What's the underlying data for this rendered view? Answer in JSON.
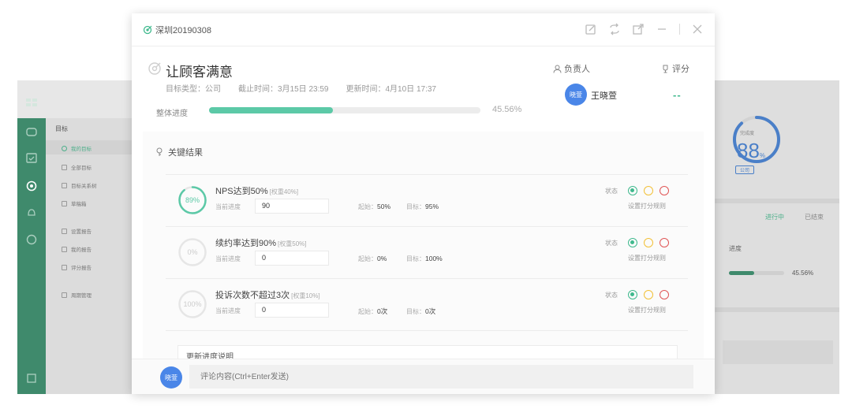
{
  "background": {
    "sidebar": {
      "title": "目标",
      "items": [
        {
          "label": "我的目标",
          "active": true
        },
        {
          "label": "全部目标",
          "active": false
        },
        {
          "label": "目标关系树",
          "active": false
        },
        {
          "label": "草稿箱",
          "active": false
        },
        {
          "label": "设置报告",
          "active": false
        },
        {
          "label": "我的报告",
          "active": false
        },
        {
          "label": "评分报告",
          "active": false
        },
        {
          "label": "周期管理",
          "active": false
        }
      ]
    },
    "right": {
      "ring_label": "完成度",
      "ring_value": "88",
      "ring_unit": "%",
      "ring_badge": "公司",
      "tab_active": "进行中",
      "tab_other": "已结束",
      "progress_label": "进度",
      "progress_value": "45.56%",
      "progress_fraction": 0.4556
    }
  },
  "modal": {
    "window_title": "深圳20190308",
    "goal": {
      "title": "让顾客满意",
      "type": "目标类型：公司",
      "deadline": "截止时间：3月15日 23:59",
      "updated": "更新时间：4月10日 17:37",
      "progress_label": "整体进度",
      "progress_value": "45.56%",
      "progress_fraction": 0.4556
    },
    "owner": {
      "label": "负责人",
      "avatar_text": "晓萱",
      "name": "王晓萱"
    },
    "score": {
      "label": "评分",
      "value": "--"
    },
    "key_results": {
      "header": "关键结果",
      "items": [
        {
          "percent": 0.89,
          "percent_text": "89%",
          "name": "NPS达到50%",
          "weight": "[权重40%]",
          "current_label": "当前进度",
          "current_value": "90",
          "start_label": "起始：",
          "start_value": "50%",
          "target_label": "目标：",
          "target_value": "95%",
          "status_label": "状态",
          "rule_label": "设置打分规则"
        },
        {
          "percent": 0.0,
          "percent_text": "0%",
          "name": "续约率达到90%",
          "weight": "[权重50%]",
          "current_label": "当前进度",
          "current_value": "0",
          "start_label": "起始：",
          "start_value": "0%",
          "target_label": "目标：",
          "target_value": "100%",
          "status_label": "状态",
          "rule_label": "设置打分规则"
        },
        {
          "percent": 0.0,
          "percent_text": "100%",
          "name": "投诉次数不超过3次",
          "weight": "[权重10%]",
          "current_label": "当前进度",
          "current_value": "0",
          "start_label": "起始：",
          "start_value": "0次",
          "target_label": "目标：",
          "target_value": "0次",
          "status_label": "状态",
          "rule_label": "设置打分规则"
        }
      ]
    },
    "update_note_title": "更新进度说明",
    "comment": {
      "avatar_text": "晓萱",
      "placeholder": "评论内容(Ctrl+Enter发送)"
    },
    "colors": {
      "accent": "#5cc9a7",
      "avatar": "#4a86e8",
      "status_green": "#3fb98d",
      "status_yellow": "#f2c037",
      "status_red": "#e05555"
    }
  }
}
